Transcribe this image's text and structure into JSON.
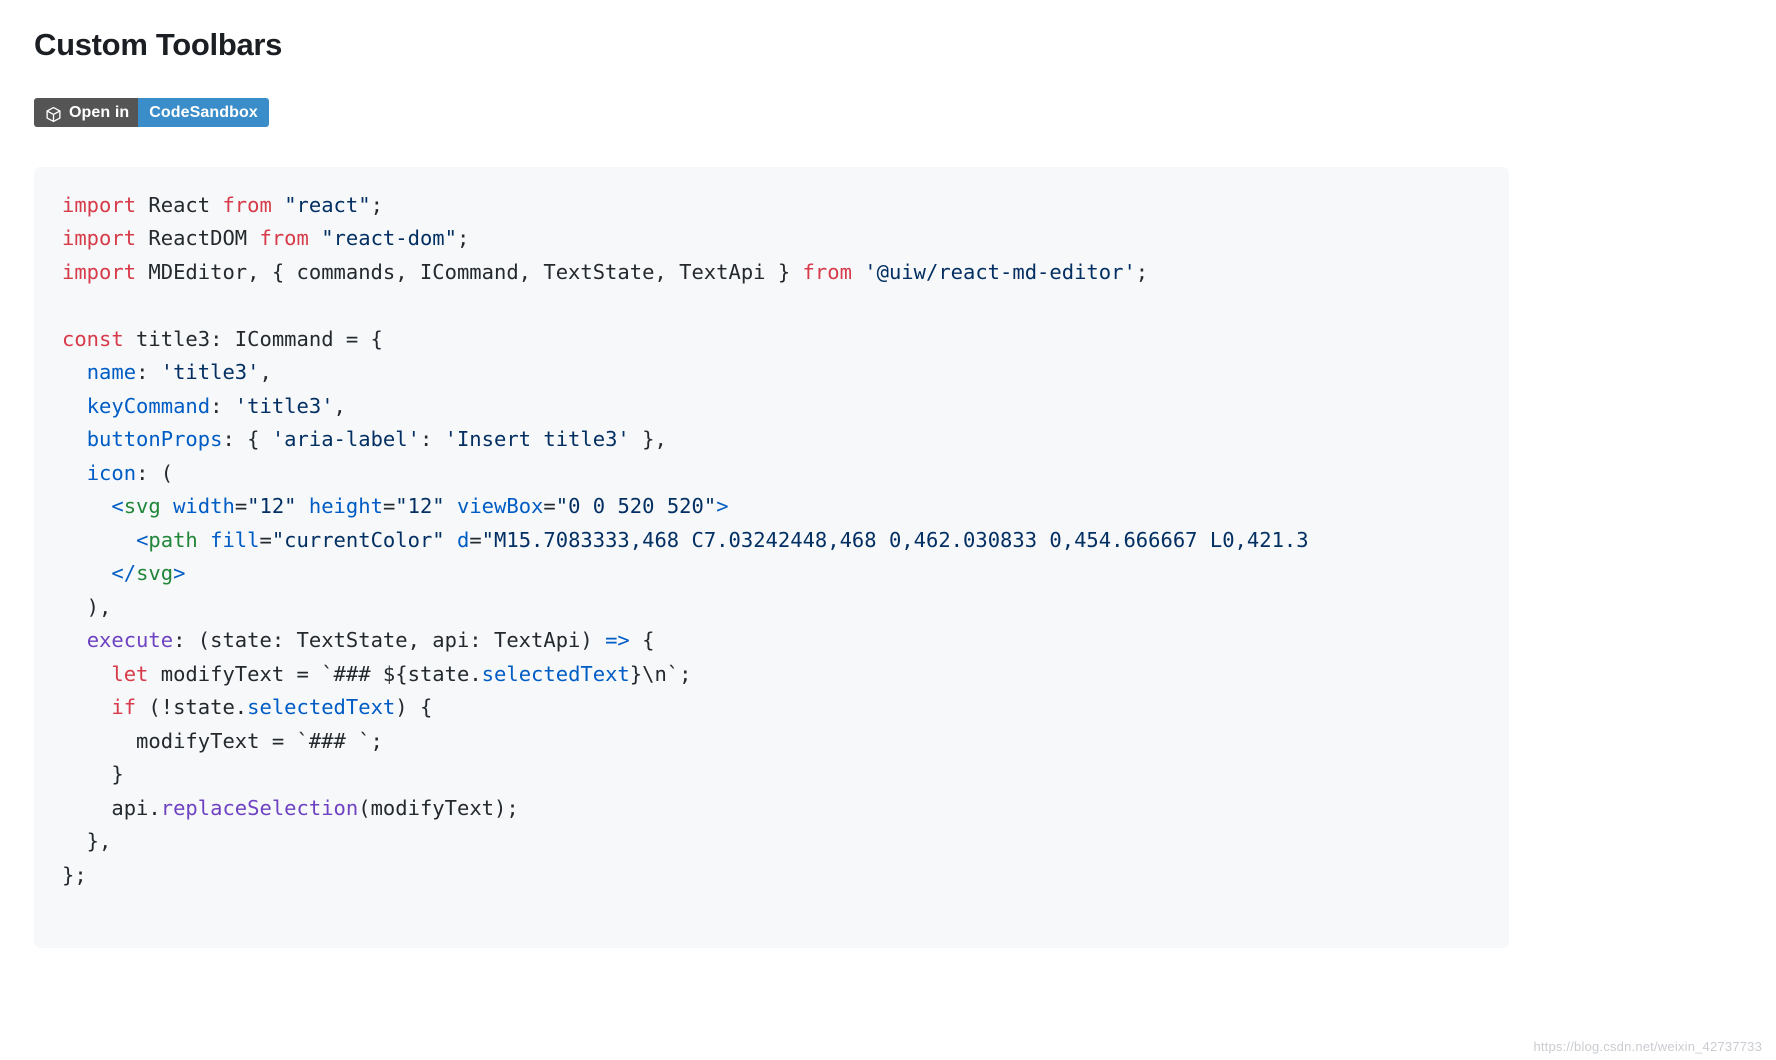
{
  "page": {
    "title": "Custom Toolbars"
  },
  "badge": {
    "icon": "codesandbox-box-icon",
    "left_label": "Open in",
    "right_label": "CodeSandbox",
    "left_color": "#555555",
    "right_color": "#3b8dc9",
    "text_color": "#ffffff"
  },
  "code_block": {
    "background": "#f6f8fa",
    "language": "tsx",
    "theme_colors": {
      "keyword": "#d73a49",
      "string": "#032f62",
      "property": "#005cc5",
      "tag": "#22863a",
      "function": "#6f42c1",
      "default": "#24292e"
    },
    "lines": [
      [
        {
          "t": "import",
          "c": "k"
        },
        {
          "t": " React ",
          "c": "d"
        },
        {
          "t": "from",
          "c": "k"
        },
        {
          "t": " ",
          "c": "d"
        },
        {
          "t": "\"react\"",
          "c": "s"
        },
        {
          "t": ";",
          "c": "d"
        }
      ],
      [
        {
          "t": "import",
          "c": "k"
        },
        {
          "t": " ReactDOM ",
          "c": "d"
        },
        {
          "t": "from",
          "c": "k"
        },
        {
          "t": " ",
          "c": "d"
        },
        {
          "t": "\"react-dom\"",
          "c": "s"
        },
        {
          "t": ";",
          "c": "d"
        }
      ],
      [
        {
          "t": "import",
          "c": "k"
        },
        {
          "t": " MDEditor, { commands, ICommand, TextState, TextApi } ",
          "c": "d"
        },
        {
          "t": "from",
          "c": "k"
        },
        {
          "t": " ",
          "c": "d"
        },
        {
          "t": "'@uiw/react-md-editor'",
          "c": "s"
        },
        {
          "t": ";",
          "c": "d"
        }
      ],
      [],
      [
        {
          "t": "const",
          "c": "k"
        },
        {
          "t": " title3: ICommand = {",
          "c": "d"
        }
      ],
      [
        {
          "t": "  ",
          "c": "d"
        },
        {
          "t": "name",
          "c": "p"
        },
        {
          "t": ": ",
          "c": "d"
        },
        {
          "t": "'title3'",
          "c": "s"
        },
        {
          "t": ",",
          "c": "d"
        }
      ],
      [
        {
          "t": "  ",
          "c": "d"
        },
        {
          "t": "keyCommand",
          "c": "p"
        },
        {
          "t": ": ",
          "c": "d"
        },
        {
          "t": "'title3'",
          "c": "s"
        },
        {
          "t": ",",
          "c": "d"
        }
      ],
      [
        {
          "t": "  ",
          "c": "d"
        },
        {
          "t": "buttonProps",
          "c": "p"
        },
        {
          "t": ": { ",
          "c": "d"
        },
        {
          "t": "'aria-label'",
          "c": "s"
        },
        {
          "t": ": ",
          "c": "d"
        },
        {
          "t": "'Insert title3'",
          "c": "s"
        },
        {
          "t": " },",
          "c": "d"
        }
      ],
      [
        {
          "t": "  ",
          "c": "d"
        },
        {
          "t": "icon",
          "c": "p"
        },
        {
          "t": ": (",
          "c": "d"
        }
      ],
      [
        {
          "t": "    ",
          "c": "d"
        },
        {
          "t": "<",
          "c": "p"
        },
        {
          "t": "svg",
          "c": "t"
        },
        {
          "t": " ",
          "c": "d"
        },
        {
          "t": "width",
          "c": "p"
        },
        {
          "t": "=",
          "c": "d"
        },
        {
          "t": "\"12\"",
          "c": "s"
        },
        {
          "t": " ",
          "c": "d"
        },
        {
          "t": "height",
          "c": "p"
        },
        {
          "t": "=",
          "c": "d"
        },
        {
          "t": "\"12\"",
          "c": "s"
        },
        {
          "t": " ",
          "c": "d"
        },
        {
          "t": "viewBox",
          "c": "p"
        },
        {
          "t": "=",
          "c": "d"
        },
        {
          "t": "\"0 0 520 520\"",
          "c": "s"
        },
        {
          "t": ">",
          "c": "p"
        }
      ],
      [
        {
          "t": "      ",
          "c": "d"
        },
        {
          "t": "<",
          "c": "p"
        },
        {
          "t": "path",
          "c": "t"
        },
        {
          "t": " ",
          "c": "d"
        },
        {
          "t": "fill",
          "c": "p"
        },
        {
          "t": "=",
          "c": "d"
        },
        {
          "t": "\"currentColor\"",
          "c": "s"
        },
        {
          "t": " ",
          "c": "d"
        },
        {
          "t": "d",
          "c": "p"
        },
        {
          "t": "=",
          "c": "d"
        },
        {
          "t": "\"M15.7083333,468 C7.03242448,468 0,462.030833 0,454.666667 L0,421.3",
          "c": "s"
        }
      ],
      [
        {
          "t": "    ",
          "c": "d"
        },
        {
          "t": "</",
          "c": "p"
        },
        {
          "t": "svg",
          "c": "t"
        },
        {
          "t": ">",
          "c": "p"
        }
      ],
      [
        {
          "t": "  ),",
          "c": "d"
        }
      ],
      [
        {
          "t": "  ",
          "c": "d"
        },
        {
          "t": "execute",
          "c": "f"
        },
        {
          "t": ": (state: TextState, api: TextApi) ",
          "c": "d"
        },
        {
          "t": "=>",
          "c": "p"
        },
        {
          "t": " {",
          "c": "d"
        }
      ],
      [
        {
          "t": "    ",
          "c": "d"
        },
        {
          "t": "let",
          "c": "k"
        },
        {
          "t": " modifyText = ",
          "c": "d"
        },
        {
          "t": "`### ${",
          "c": "d"
        },
        {
          "t": "state.",
          "c": "d"
        },
        {
          "t": "selectedText",
          "c": "p"
        },
        {
          "t": "}\\n`",
          "c": "d"
        },
        {
          "t": ";",
          "c": "d"
        }
      ],
      [
        {
          "t": "    ",
          "c": "d"
        },
        {
          "t": "if",
          "c": "k"
        },
        {
          "t": " (!state.",
          "c": "d"
        },
        {
          "t": "selectedText",
          "c": "p"
        },
        {
          "t": ") {",
          "c": "d"
        }
      ],
      [
        {
          "t": "      modifyText = `### `;",
          "c": "d"
        }
      ],
      [
        {
          "t": "    }",
          "c": "d"
        }
      ],
      [
        {
          "t": "    api.",
          "c": "d"
        },
        {
          "t": "replaceSelection",
          "c": "f"
        },
        {
          "t": "(modifyText);",
          "c": "d"
        }
      ],
      [
        {
          "t": "  },",
          "c": "d"
        }
      ],
      [
        {
          "t": "};",
          "c": "d"
        }
      ],
      []
    ]
  },
  "watermark": {
    "text": "https://blog.csdn.net/weixin_42737733"
  }
}
